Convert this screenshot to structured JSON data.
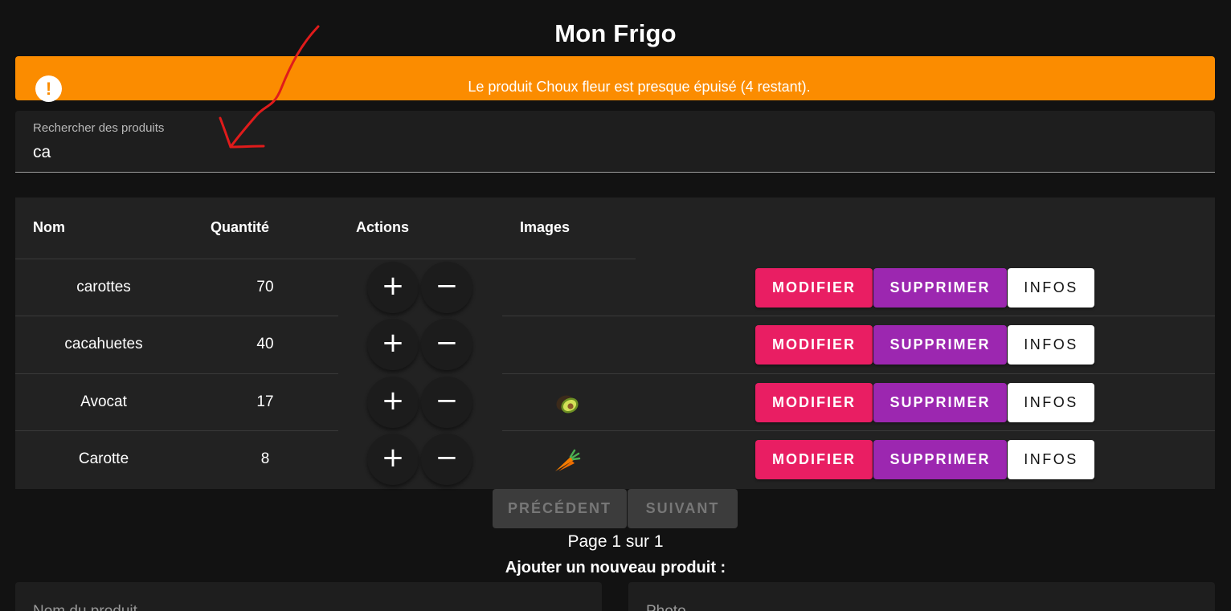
{
  "header": {
    "title": "Mon Frigo"
  },
  "alert": {
    "icon": "exclamation-icon",
    "icon_glyph": "!",
    "message": "Le produit Choux fleur est presque épuisé (4 restant).",
    "color": "#fb8c00"
  },
  "search": {
    "label": "Rechercher des produits",
    "value": "ca"
  },
  "table": {
    "columns": {
      "name": "Nom",
      "quantity": "Quantité",
      "actions": "Actions",
      "images": "Images"
    },
    "rows": [
      {
        "name": "carottes",
        "quantity": "70",
        "image": ""
      },
      {
        "name": "cacahuetes",
        "quantity": "40",
        "image": ""
      },
      {
        "name": "Avocat",
        "quantity": "17",
        "image": "avocado-icon"
      },
      {
        "name": "Carotte",
        "quantity": "8",
        "image": "carrot-icon"
      }
    ],
    "increment_glyph": "+",
    "decrement_glyph": "−",
    "buttons": {
      "edit": "MODIFIER",
      "delete": "SUPPRIMER",
      "info": "INFOS"
    },
    "colors": {
      "edit": "#e91e63",
      "delete": "#9c27b0",
      "info": "#ffffff"
    }
  },
  "pagination": {
    "previous": "PRÉCÉDENT",
    "next": "SUIVANT",
    "page_info": "Page 1 sur 1"
  },
  "add_product": {
    "title": "Ajouter un nouveau produit :",
    "name_label": "Nom du produit",
    "photo_label": "Photo"
  }
}
